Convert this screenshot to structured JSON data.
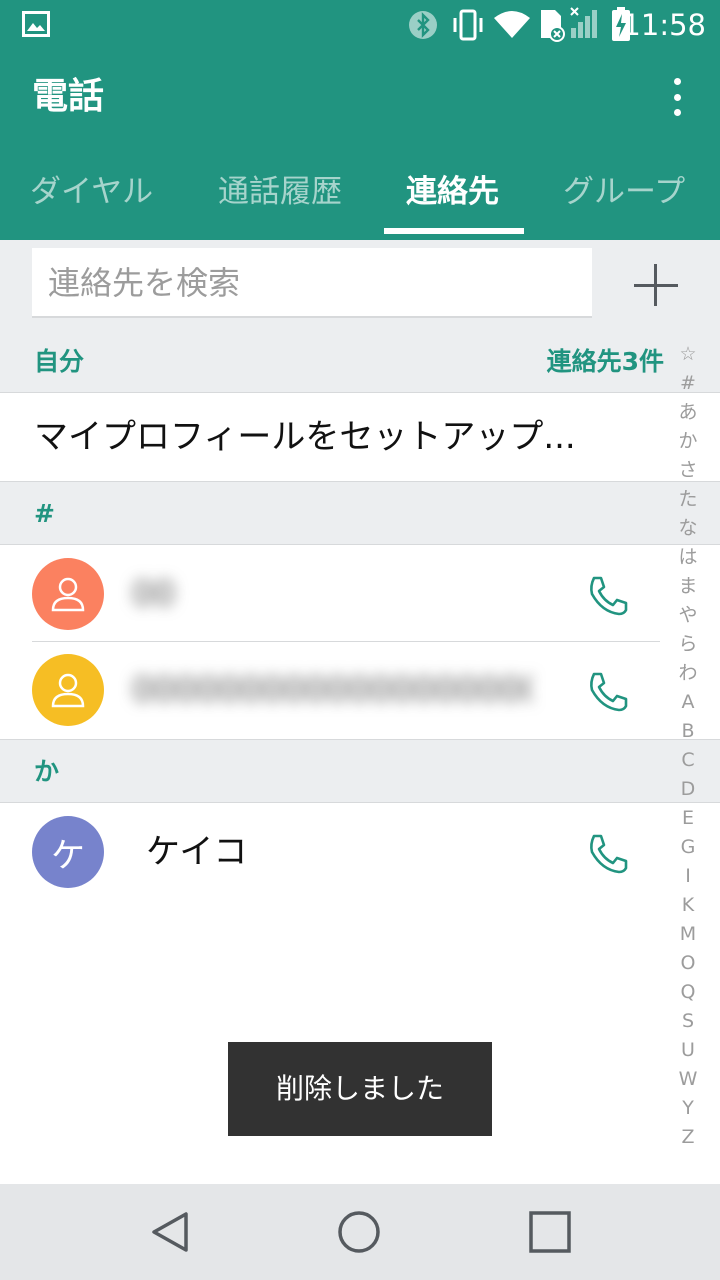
{
  "status_bar": {
    "time": "11:58",
    "icons": [
      "image-notification-icon",
      "bluetooth-icon",
      "vibrate-icon",
      "wifi-icon",
      "sd-card-icon",
      "no-signal-icon",
      "battery-charging-icon"
    ]
  },
  "app": {
    "title": "電話",
    "menu_icon": "more-vert-icon"
  },
  "tabs": [
    {
      "label": "ダイヤル",
      "active": false
    },
    {
      "label": "通話履歴",
      "active": false
    },
    {
      "label": "連絡先",
      "active": true
    },
    {
      "label": "グループ",
      "active": false
    }
  ],
  "search": {
    "placeholder": "連絡先を検索",
    "value": "",
    "add_icon": "plus-icon"
  },
  "self_section": {
    "header": "自分",
    "count": "連絡先3件",
    "profile_setup": "マイプロフィールをセットアップ..."
  },
  "sections": [
    {
      "header": "#",
      "contacts": [
        {
          "name": "00",
          "avatar_color": "#fb8160",
          "avatar": "person-icon",
          "blurred": true
        },
        {
          "name": "00000000000000000000",
          "avatar_color": "#f6be24",
          "avatar": "person-icon",
          "blurred": true
        }
      ]
    },
    {
      "header": "か",
      "contacts": [
        {
          "name": "ケイコ",
          "avatar_color": "#7783cc",
          "avatar_initial": "ケ",
          "blurred": false
        }
      ]
    }
  ],
  "index_letters": [
    "☆",
    "#",
    "あ",
    "か",
    "さ",
    "た",
    "な",
    "は",
    "ま",
    "や",
    "ら",
    "わ",
    "A",
    "B",
    "C",
    "D",
    "E",
    "G",
    "I",
    "K",
    "M",
    "O",
    "Q",
    "S",
    "U",
    "W",
    "Y",
    "Z"
  ],
  "toast": "削除しました",
  "colors": {
    "primary": "#219480",
    "accent_text": "#219480",
    "section_bg": "#eceef0",
    "toast_bg": "#323232"
  },
  "nav_bar": [
    "back-icon",
    "home-icon",
    "recents-icon"
  ]
}
